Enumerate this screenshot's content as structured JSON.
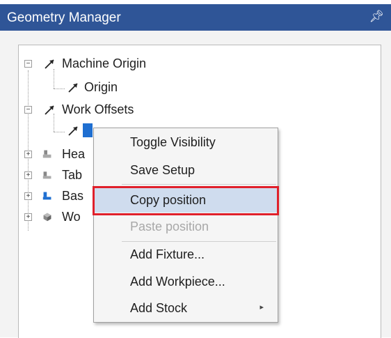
{
  "window": {
    "title": "Geometry Manager",
    "pin_icon": "pin-icon"
  },
  "tree": {
    "nodes": [
      {
        "label": "Machine Origin",
        "icon": "arrow-icon",
        "expander": "−"
      },
      {
        "label": "Origin",
        "icon": "arrow-icon"
      },
      {
        "label": "Work Offsets",
        "icon": "arrow-icon",
        "expander": "−"
      },
      {
        "label": "",
        "icon": "arrow-icon"
      },
      {
        "label": "Hea",
        "icon": "head-icon",
        "expander": "+"
      },
      {
        "label": "Tab",
        "icon": "table-icon",
        "expander": "+"
      },
      {
        "label": "Bas",
        "icon": "base-icon",
        "expander": "+"
      },
      {
        "label": "Wo",
        "icon": "workpiece-icon",
        "expander": "+"
      }
    ]
  },
  "context_menu": {
    "items": [
      {
        "label": "Toggle Visibility",
        "enabled": true
      },
      {
        "label": "Save Setup",
        "enabled": true
      },
      {
        "label": "Copy position",
        "enabled": true,
        "highlighted": true
      },
      {
        "label": "Paste position",
        "enabled": false
      },
      {
        "label": "Add Fixture...",
        "enabled": true
      },
      {
        "label": "Add Workpiece...",
        "enabled": true
      },
      {
        "label": "Add Stock",
        "enabled": true,
        "submenu": "▸"
      }
    ]
  },
  "colors": {
    "titlebar": "#2f5597",
    "highlight": "#cfdcee",
    "highlight_border": "#e0202b"
  }
}
